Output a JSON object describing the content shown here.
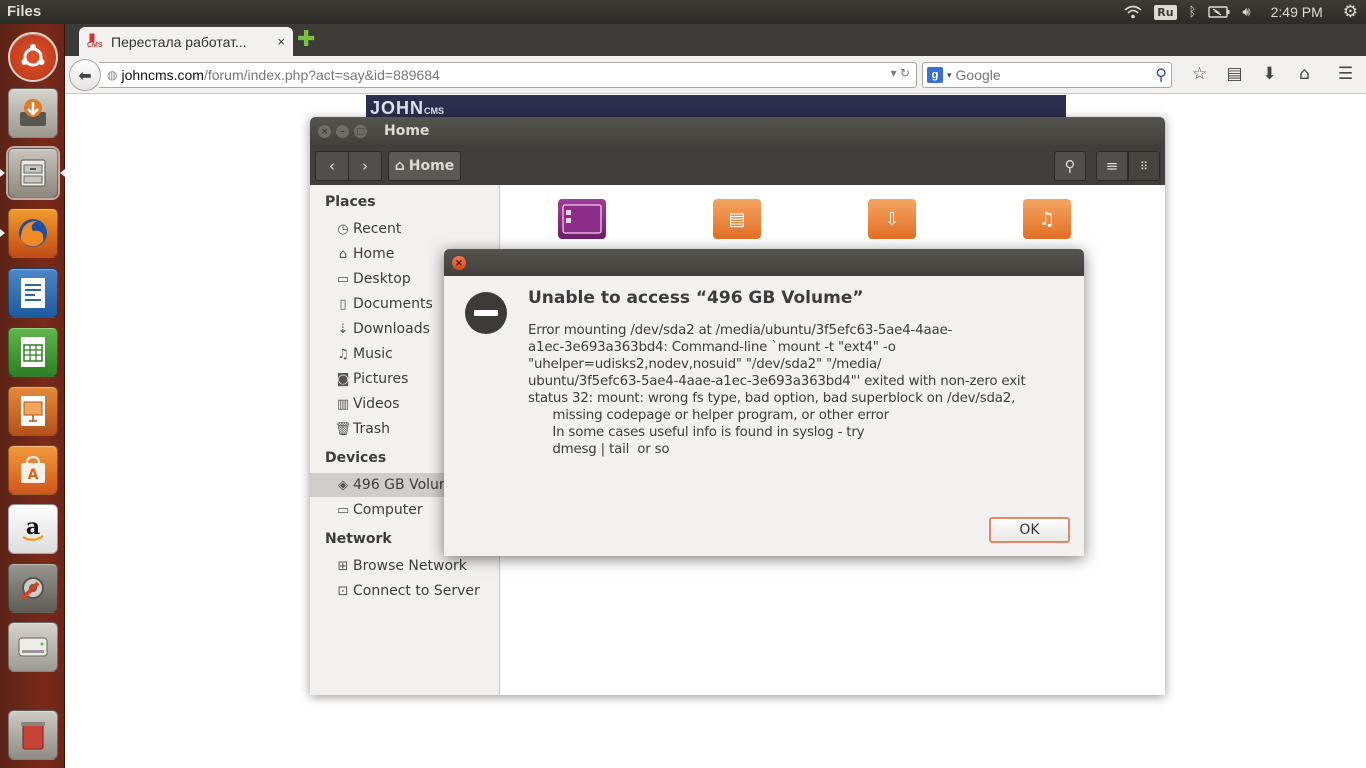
{
  "topbar": {
    "app_name": "Files",
    "keyboard_layout": "Ru",
    "clock": "2:49 PM",
    "icons": [
      "wifi-icon",
      "keyboard-icon",
      "bluetooth-icon",
      "battery-icon",
      "volume-icon",
      "gear-icon"
    ]
  },
  "launcher": {
    "items": [
      {
        "name": "dash-home",
        "icon": "ubuntu-logo-icon"
      },
      {
        "name": "installer",
        "icon": "installer-icon"
      },
      {
        "name": "files",
        "icon": "file-cabinet-icon"
      },
      {
        "name": "firefox",
        "icon": "firefox-icon"
      },
      {
        "name": "writer",
        "icon": "writer-icon"
      },
      {
        "name": "calc",
        "icon": "calc-icon"
      },
      {
        "name": "impress",
        "icon": "impress-icon"
      },
      {
        "name": "software-center",
        "icon": "shopping-bag-icon"
      },
      {
        "name": "amazon",
        "icon": "amazon-icon"
      },
      {
        "name": "system-settings",
        "icon": "settings-icon"
      },
      {
        "name": "disk",
        "icon": "hard-drive-icon"
      },
      {
        "name": "trash",
        "icon": "trash-icon"
      }
    ]
  },
  "browser": {
    "tab_title": "Перестала работат...",
    "tab_close": "×",
    "new_tab": "✚",
    "url_host": "johncms.com",
    "url_path": "/forum/index.php?act=say&id=889684",
    "search_placeholder": "Google",
    "page_header": "JOHN",
    "page_header_small": "CMS"
  },
  "files_window": {
    "title": "Home",
    "path_button": "Home",
    "sidebar": {
      "places_header": "Places",
      "places": [
        "Recent",
        "Home",
        "Desktop",
        "Documents",
        "Downloads",
        "Music",
        "Pictures",
        "Videos",
        "Trash"
      ],
      "devices_header": "Devices",
      "devices": [
        "496 GB Volum",
        "Computer"
      ],
      "network_header": "Network",
      "network": [
        "Browse Network",
        "Connect to Server"
      ]
    }
  },
  "dialog": {
    "title": "Unable to access “496 GB Volume”",
    "message": "Error mounting /dev/sda2 at /media/ubuntu/3f5efc63-5ae4-4aae-\na1ec-3e693a363bd4: Command-line `mount -t \"ext4\" -o\n\"uhelper=udisks2,nodev,nosuid\" \"/dev/sda2\" \"/media/\nubuntu/3f5efc63-5ae4-4aae-a1ec-3e693a363bd4\"' exited with non-zero exit\nstatus 32: mount: wrong fs type, bad option, bad superblock on /dev/sda2,\n      missing codepage or helper program, or other error\n      In some cases useful info is found in syslog - try\n      dmesg | tail  or so",
    "ok_label": "OK"
  }
}
